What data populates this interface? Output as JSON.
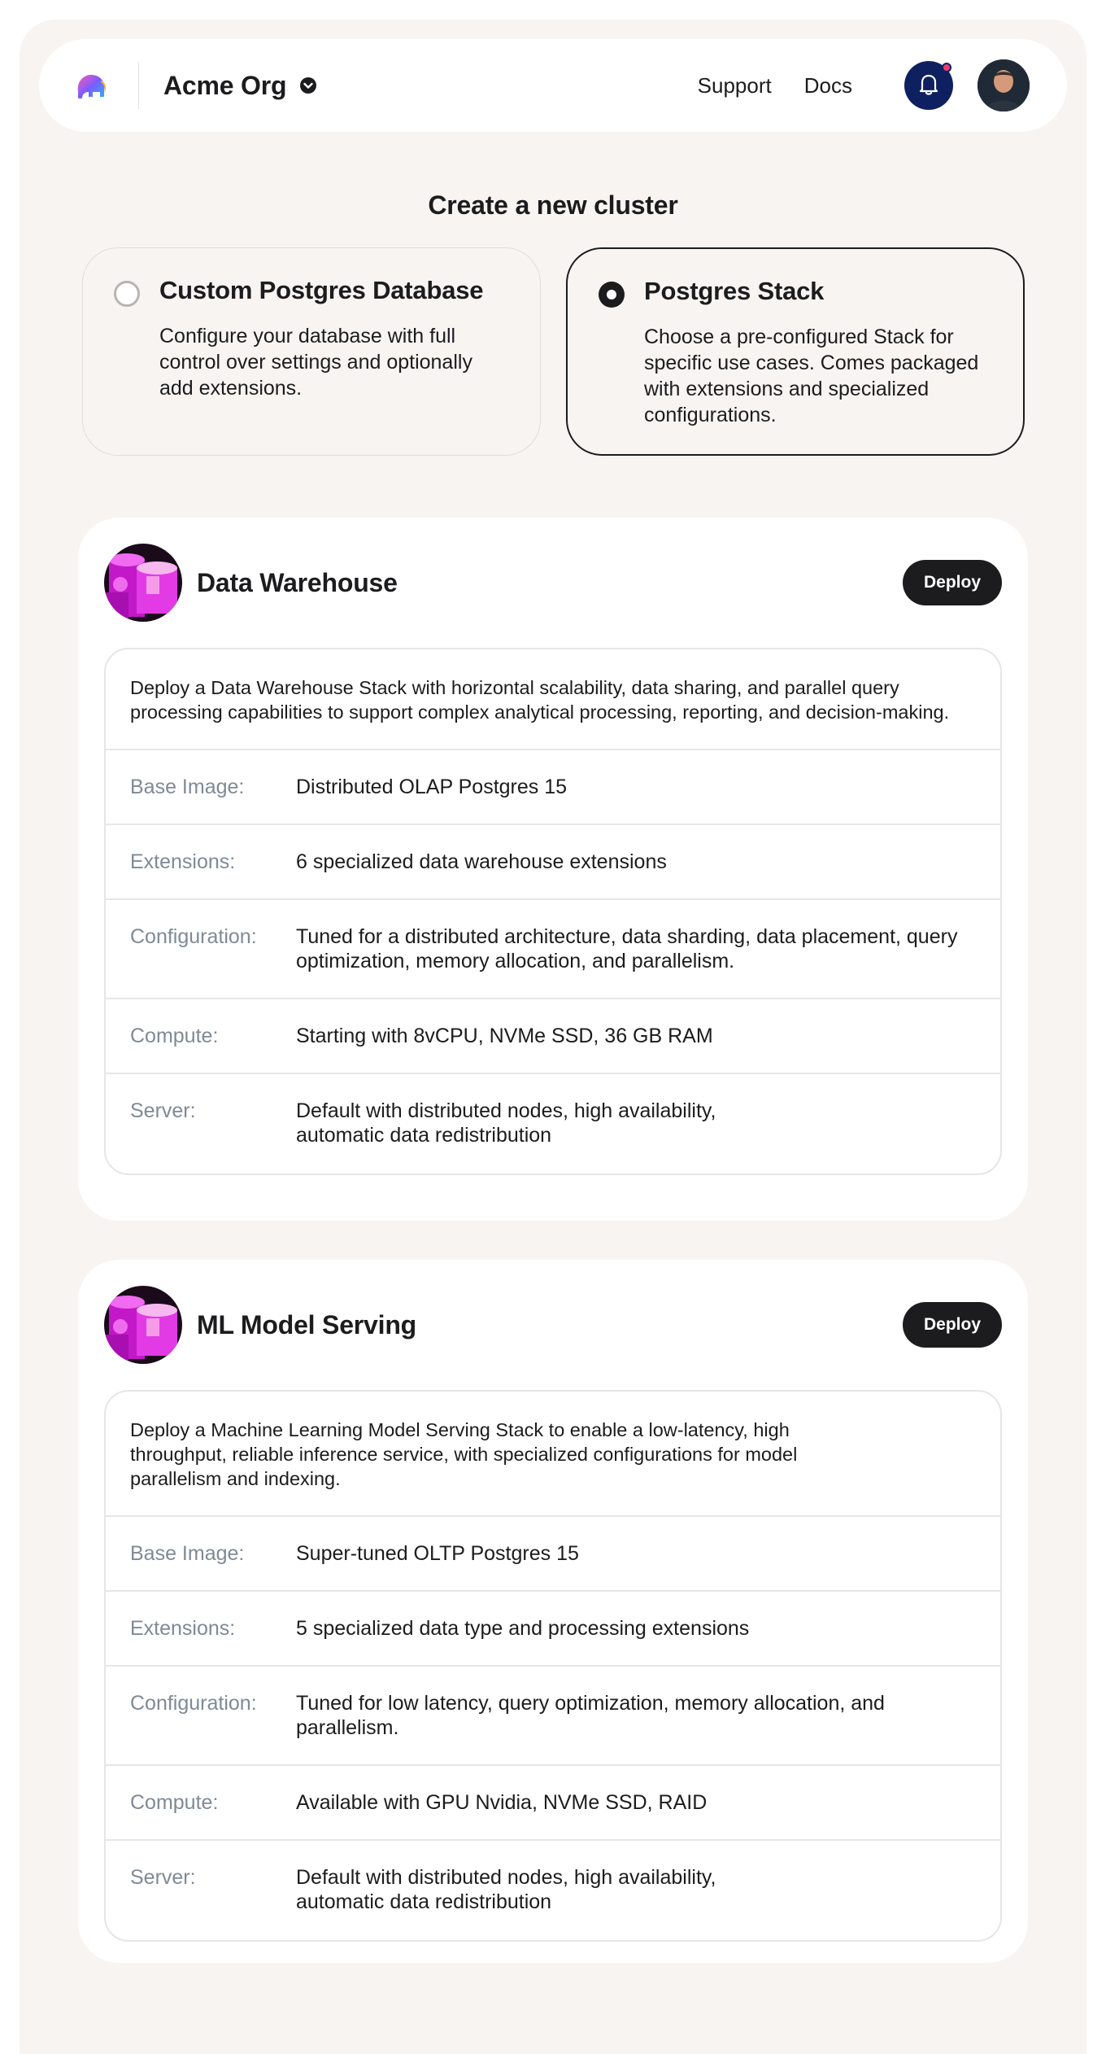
{
  "header": {
    "org_name": "Acme Org",
    "nav": [
      "Support",
      "Docs"
    ],
    "logo_icon": "elephant-logo-icon",
    "notification_icon": "bell-icon"
  },
  "page_title": "Create a new cluster",
  "options": [
    {
      "title": "Custom Postgres Database",
      "description": "Configure your database with full control over settings and optionally add extensions.",
      "selected": false
    },
    {
      "title": "Postgres Stack",
      "description": "Choose a pre-configured Stack for specific use cases. Comes packaged with extensions and specialized configurations.",
      "selected": true
    }
  ],
  "stacks": [
    {
      "name": "Data Warehouse",
      "deploy_label": "Deploy",
      "description": "Deploy a Data Warehouse Stack with horizontal scalability, data sharing, and parallel query processing capabilities to support complex analytical processing, reporting, and decision-making.",
      "rows": [
        {
          "label": "Base Image:",
          "value": "Distributed OLAP Postgres 15"
        },
        {
          "label": "Extensions:",
          "value": "6 specialized data warehouse extensions"
        },
        {
          "label": "Configuration:",
          "value": "Tuned for a distributed architecture, data sharding, data placement, query optimization, memory allocation, and parallelism."
        },
        {
          "label": "Compute:",
          "value": "Starting with 8vCPU, NVMe SSD, 36 GB RAM"
        },
        {
          "label": "Server:",
          "value": "Default with distributed nodes, high availability, automatic data redistribution"
        }
      ]
    },
    {
      "name": "ML Model Serving",
      "deploy_label": "Deploy",
      "description": "Deploy a Machine Learning Model Serving Stack to enable a low-latency, high throughput, reliable inference service, with specialized configurations for model parallelism and indexing.",
      "rows": [
        {
          "label": "Base Image:",
          "value": "Super-tuned OLTP Postgres 15"
        },
        {
          "label": "Extensions:",
          "value": "5 specialized data type and processing extensions"
        },
        {
          "label": "Configuration:",
          "value": "Tuned for low latency, query optimization, memory allocation, and parallelism."
        },
        {
          "label": "Compute:",
          "value": "Available with GPU Nvidia, NVMe SSD, RAID"
        },
        {
          "label": "Server:",
          "value": "Default with distributed nodes, high availability, automatic data redistribution"
        }
      ]
    }
  ],
  "colors": {
    "background": "#f7f4f2",
    "accent_dark": "#1c1c1e",
    "notification_bg": "#0f2060",
    "notification_dot": "#ef3b6b",
    "stack_thumb": "#d61fd6"
  }
}
